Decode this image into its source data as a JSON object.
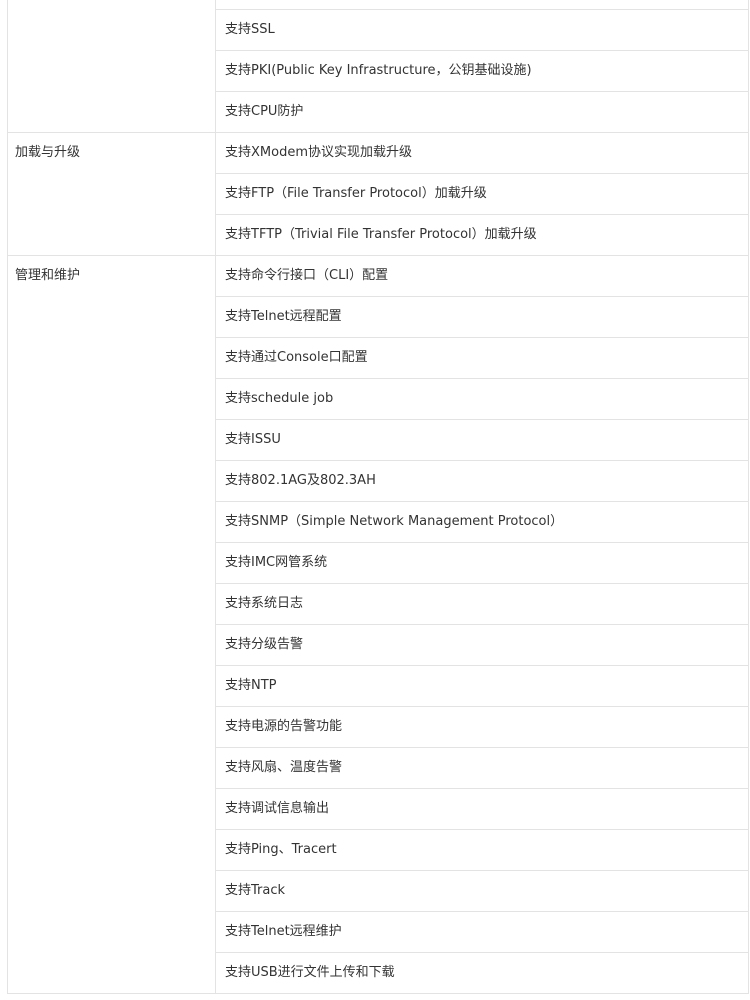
{
  "table": {
    "groups": [
      {
        "category": "",
        "items": [
          "",
          "支持SSL",
          "支持PKI(Public Key Infrastructure，公钥基础设施)",
          "支持CPU防护"
        ]
      },
      {
        "category": "加载与升级",
        "items": [
          "支持XModem协议实现加载升级",
          "支持FTP（File Transfer Protocol）加载升级",
          "支持TFTP（Trivial File Transfer Protocol）加载升级"
        ]
      },
      {
        "category": "管理和维护",
        "items": [
          "支持命令行接口（CLI）配置",
          "支持Telnet远程配置",
          "支持通过Console口配置",
          "支持schedule job",
          "支持ISSU",
          "支持802.1AG及802.3AH",
          "支持SNMP（Simple Network Management Protocol）",
          "支持IMC网管系统",
          "支持系统日志",
          "支持分级告警",
          "支持NTP",
          "支持电源的告警功能",
          "支持风扇、温度告警",
          "支持调试信息输出",
          "支持Ping、Tracert",
          "支持Track",
          "支持Telnet远程维护",
          "支持USB进行文件上传和下载"
        ]
      }
    ]
  }
}
